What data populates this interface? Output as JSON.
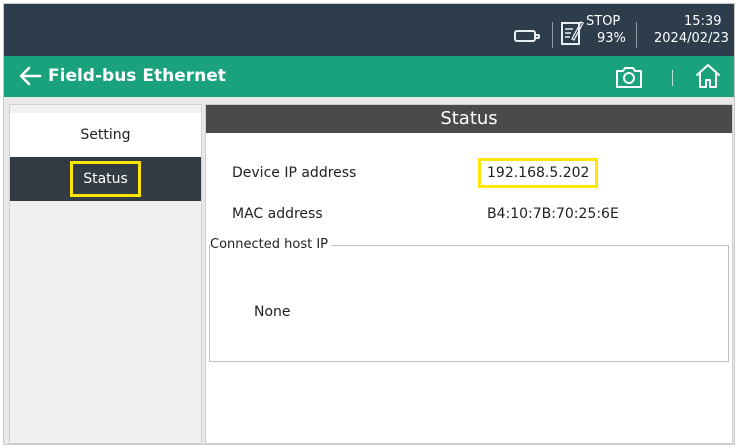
{
  "statusbar": {
    "stop_label": "STOP",
    "battery_percent": "93%",
    "time": "15:39",
    "date": "2024/02/23",
    "icons": [
      "battery-icon",
      "document-edit-icon"
    ]
  },
  "titlebar": {
    "title": "Field-bus Ethernet",
    "icons": [
      "back-arrow-icon",
      "camera-icon",
      "home-icon"
    ],
    "color": "#1aa27d"
  },
  "nav": {
    "items": [
      {
        "label": "Setting",
        "selected": false
      },
      {
        "label": "Status",
        "selected": true
      }
    ]
  },
  "main": {
    "header": "Status",
    "device_ip_label": "Device IP address",
    "device_ip_value": "192.168.5.202",
    "mac_label": "MAC address",
    "mac_value": "B4:10:7B:70:25:6E",
    "connected_host_label": "Connected host IP",
    "connected_host_value": "None"
  },
  "colors": {
    "statusbar_bg": "#2d3d4b",
    "highlight": "#ffe600",
    "nav_selected_bg": "#333b44",
    "panel_header_bg": "#4a4a4a"
  }
}
